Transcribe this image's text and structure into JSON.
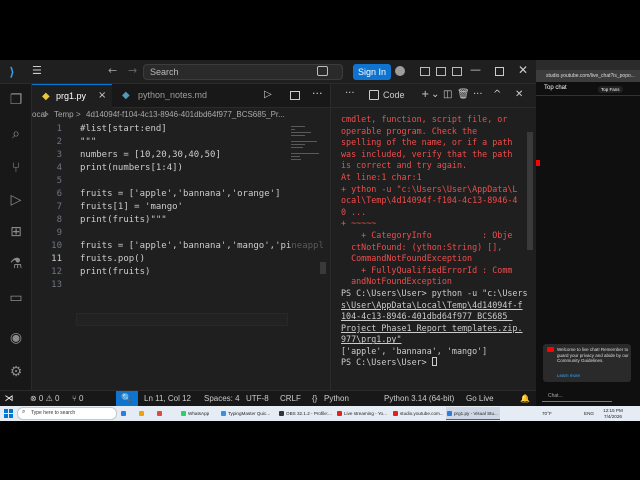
{
  "vscode": {
    "search_placeholder": "Search",
    "signin_label": "Sign In",
    "tabs": [
      {
        "label": "prg1.py",
        "close": "×"
      },
      {
        "label": "python_notes.md"
      }
    ],
    "breadcrumb": [
      "ocal",
      ">",
      "Temp",
      ">",
      "4d14094f-f104-4c13-8946-401dbd64f977_BCS685_Pr..."
    ],
    "code_lines": [
      {
        "n": "1",
        "text": "#list[start:end]"
      },
      {
        "n": "2",
        "text": "\"\"\""
      },
      {
        "n": "3",
        "text": "numbers = [10,20,30,40,50]"
      },
      {
        "n": "4",
        "text": "print(numbers[1:4])"
      },
      {
        "n": "5",
        "text": ""
      },
      {
        "n": "6",
        "text": "fruits = ['apple','bannana','orange']"
      },
      {
        "n": "7",
        "text": "fruits[1] = 'mango'"
      },
      {
        "n": "8",
        "text": "print(fruits)\"\"\""
      },
      {
        "n": "9",
        "text": ""
      },
      {
        "n": "10",
        "text": "fruits = ['apple','bannana','mango','pi"
      },
      {
        "n": "11",
        "text": "fruits.pop()"
      },
      {
        "n": "12",
        "text": "print(fruits)"
      },
      {
        "n": "13",
        "text": ""
      }
    ],
    "line10_ghost": "neappl",
    "panel": {
      "title": "Code"
    },
    "terminal_lines": [
      {
        "cls": "err",
        "text": "cmdlet, function, script file, or"
      },
      {
        "cls": "err",
        "text": "operable program. Check the"
      },
      {
        "cls": "err",
        "text": "spelling of the name, or if a path"
      },
      {
        "cls": "err",
        "text": "was included, verify that the path"
      },
      {
        "cls": "err",
        "text": "is correct and try again."
      },
      {
        "cls": "err",
        "text": "At line:1 char:1"
      },
      {
        "cls": "err",
        "text": "+ ython -u \"c:\\Users\\User\\AppData\\L"
      },
      {
        "cls": "err",
        "text": "ocal\\Temp\\4d14094f-f104-4c13-8946-4"
      },
      {
        "cls": "err",
        "text": "0 ..."
      },
      {
        "cls": "err",
        "text": "+ ~~~~~"
      },
      {
        "cls": "err",
        "text": "    + CategoryInfo          : Obje"
      },
      {
        "cls": "err",
        "text": "  ctNotFound: (ython:String) [],"
      },
      {
        "cls": "err",
        "text": "  CommandNotFoundException"
      },
      {
        "cls": "err",
        "text": "    + FullyQualifiedErrorId : Comm"
      },
      {
        "cls": "err",
        "text": "  andNotFoundException"
      },
      {
        "cls": "norm",
        "text": ""
      },
      {
        "cls": "norm",
        "text": "PS C:\\Users\\User> python -u \"c:\\Users"
      },
      {
        "cls": "norm ul",
        "text": "s\\User\\AppData\\Local\\Temp\\4d14094f-f"
      },
      {
        "cls": "norm ul",
        "text": "104-4c13-8946-401dbd64f977_BCS685_"
      },
      {
        "cls": "norm ul",
        "text": "Project_Phase1_Report_templates.zip."
      },
      {
        "cls": "norm ul",
        "text": "977\\prg1.py\""
      },
      {
        "cls": "norm",
        "text": "['apple', 'bannana', 'mango']"
      },
      {
        "cls": "norm",
        "text": "PS C:\\Users\\User> "
      }
    ],
    "status": {
      "problems": "⊗ 0 ⚠ 0",
      "ports": "⑂ 0",
      "position": "Ln 11, Col 12",
      "spaces": "Spaces: 4",
      "encoding": "UTF-8",
      "eol": "CRLF",
      "language": "Python",
      "interpreter": "Python 3.14 (64-bit)",
      "golive": "Go Live"
    }
  },
  "browser": {
    "url": "studio.youtube.com/live_chat?is_popo...",
    "top_chat": "Top chat",
    "top_fans": "Top Fans",
    "welcome": "Welcome to live chat! Remember to guard your privacy and abide by our Community Guidelines.",
    "learn_more": "Learn more",
    "chat_placeholder": "Chat..."
  },
  "taskbar": {
    "search": "Type here to search",
    "apps": [
      {
        "label": "",
        "color": "#2a7de1"
      },
      {
        "label": "",
        "color": "#f0a30a"
      },
      {
        "label": "",
        "color": "#e04a3a"
      },
      {
        "label": "WhatsApp",
        "color": "#25d366"
      },
      {
        "label": "TypingMaster Quic...",
        "color": "#3a8ee6"
      },
      {
        "label": "OBS 32.1.2 - Profile:...",
        "color": "#333333"
      },
      {
        "label": "Live streaming - Yo...",
        "color": "#e62117"
      },
      {
        "label": "studio.youtube.com...",
        "color": "#e62117"
      },
      {
        "label": "prg1.py - Visual Stu...",
        "color": "#2a7de1"
      }
    ],
    "weather": "70°F",
    "lang": "ENG",
    "time": "12:15 PM",
    "date": "7/4/2026"
  }
}
